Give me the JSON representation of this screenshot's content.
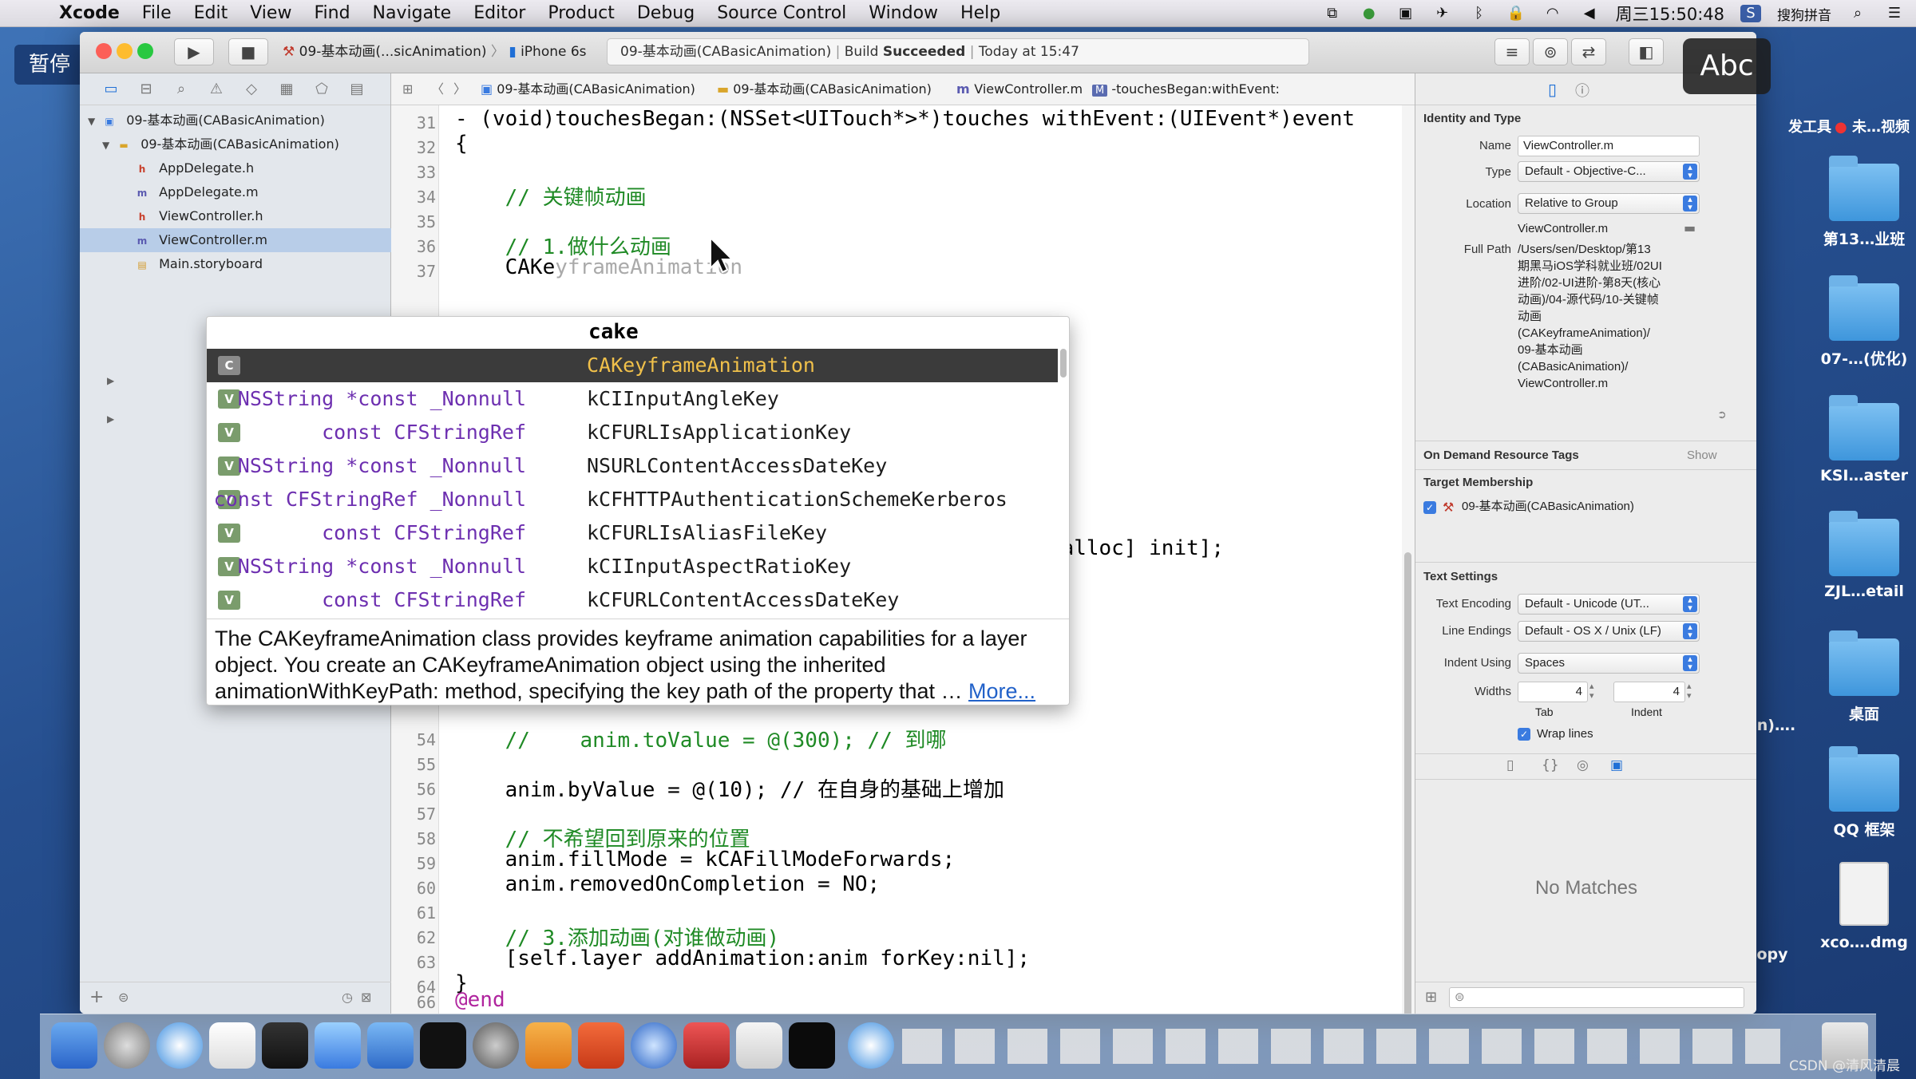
{
  "menubar": {
    "app_name": "Xcode",
    "items": [
      "File",
      "Edit",
      "View",
      "Find",
      "Navigate",
      "Editor",
      "Product",
      "Debug",
      "Source Control",
      "Window",
      "Help"
    ],
    "clock": "周三15:50:48",
    "ime": "搜狗拼音"
  },
  "overlay": {
    "pause_label": "暂停",
    "abc_label": "Abc"
  },
  "desktop_icons": [
    {
      "label": "发工具"
    },
    {
      "label": "未…视频"
    },
    {
      "label": "第13…业班"
    },
    {
      "label": "07-…(优化)"
    },
    {
      "label": "KSI…aster"
    },
    {
      "label": "ZJL…etail"
    },
    {
      "label": "桌面"
    },
    {
      "label": "n)…."
    },
    {
      "label": "QQ 框架"
    },
    {
      "label": "opy"
    },
    {
      "label": "xco….dmg"
    }
  ],
  "toolbar": {
    "scheme": "09-基本动画(...sicAnimation)",
    "device": "iPhone 6s",
    "activity_project": "09-基本动画(CABasicAnimation)",
    "activity_build": "Build",
    "activity_status": "Succeeded",
    "activity_time": "Today at 15:47"
  },
  "navigator": {
    "project": "09-基本动画(CABasicAnimation)",
    "group": "09-基本动画(CABasicAnimation)",
    "files": [
      {
        "name": "AppDelegate.h",
        "badge": "h"
      },
      {
        "name": "AppDelegate.m",
        "badge": "m"
      },
      {
        "name": "ViewController.h",
        "badge": "h"
      },
      {
        "name": "ViewController.m",
        "badge": "m",
        "selected": true
      },
      {
        "name": "Main.storyboard",
        "badge": "sb"
      }
    ]
  },
  "jumpbar": {
    "crumbs": [
      "09-基本动画(CABasicAnimation)",
      "09-基本动画(CABasicAnimation)",
      "ViewController.m",
      "-touchesBegan:withEvent:"
    ]
  },
  "editor": {
    "lines": [
      {
        "n": "31",
        "code": "- (void)touchesBegan:(NSSet<UITouch*>*)touches withEvent:(UIEvent*)event"
      },
      {
        "n": "32",
        "code": "{"
      },
      {
        "n": "33",
        "code": ""
      },
      {
        "n": "34",
        "code": "    // 关键帧动画"
      },
      {
        "n": "35",
        "code": ""
      },
      {
        "n": "36",
        "code": "    // 1.做什么动画"
      },
      {
        "n": "37",
        "code": "    CAKe"
      },
      {
        "n": "54",
        "code": "    //    anim.toValue = @(300); // 到哪"
      },
      {
        "n": "55",
        "code": ""
      },
      {
        "n": "56",
        "code": "    anim.byValue = @(10); // 在自身的基础上增加"
      },
      {
        "n": "57",
        "code": ""
      },
      {
        "n": "58",
        "code": "    // 不希望回到原来的位置"
      },
      {
        "n": "59",
        "code": "    anim.fillMode = kCAFillModeForwards;"
      },
      {
        "n": "60",
        "code": "    anim.removedOnCompletion = NO;"
      },
      {
        "n": "61",
        "code": ""
      },
      {
        "n": "62",
        "code": "    // 3.添加动画(对谁做动画)"
      },
      {
        "n": "63",
        "code": "    [self.layer addAnimation:anim forKey:nil];"
      },
      {
        "n": "64",
        "code": "}"
      },
      {
        "n": "65",
        "code": ""
      },
      {
        "n": "66",
        "code": "@end"
      }
    ],
    "ghost_suffix": "yframeAnimation",
    "hidden_fragment": "mation alloc] init];"
  },
  "completion": {
    "typed": "cake",
    "items": [
      {
        "kind": "C",
        "rtype": "",
        "name": "CAKeyframeAnimation"
      },
      {
        "kind": "V",
        "rtype": "NSString *const _Nonnull",
        "name": "kCIInputAngleKey"
      },
      {
        "kind": "V",
        "rtype": "const CFStringRef",
        "name": "kCFURLIsApplicationKey"
      },
      {
        "kind": "V",
        "rtype": "NSString *const _Nonnull",
        "name": "NSURLContentAccessDateKey"
      },
      {
        "kind": "V",
        "rtype": "const CFStringRef _Nonnull",
        "name": "kCFHTTPAuthenticationSchemeKerberos"
      },
      {
        "kind": "V",
        "rtype": "const CFStringRef",
        "name": "kCFURLIsAliasFileKey"
      },
      {
        "kind": "V",
        "rtype": "NSString *const _Nonnull",
        "name": "kCIInputAspectRatioKey"
      },
      {
        "kind": "V",
        "rtype": "const CFStringRef",
        "name": "kCFURLContentAccessDateKey"
      }
    ],
    "description": "The CAKeyframeAnimation class provides keyframe animation capabilities for a layer object. You create an CAKeyframeAnimation object using the inherited animationWithKeyPath: method, specifying the key path of the property that …",
    "more_link": "More..."
  },
  "inspector": {
    "identity_title": "Identity and Type",
    "name_label": "Name",
    "name_value": "ViewController.m",
    "type_label": "Type",
    "type_value": "Default - Objective-C...",
    "location_label": "Location",
    "location_value": "Relative to Group",
    "location_file": "ViewController.m",
    "fullpath_label": "Full Path",
    "fullpath_lines": [
      "/Users/sen/Desktop/第13",
      "期黑马iOS学科就业班/02UI",
      "进阶/02-UI进阶-第8天(核心",
      "动画)/04-源代码/10-关键帧",
      "动画",
      "(CAKeyframeAnimation)/",
      "09-基本动画",
      "(CABasicAnimation)/",
      "ViewController.m"
    ],
    "odr_title": "On Demand Resource Tags",
    "odr_show": "Show",
    "target_title": "Target Membership",
    "target_name": "09-基本动画(CABasicAnimation)",
    "text_title": "Text Settings",
    "encoding_label": "Text Encoding",
    "encoding_value": "Default - Unicode (UT...",
    "endings_label": "Line Endings",
    "endings_value": "Default - OS X / Unix (LF)",
    "indent_label": "Indent Using",
    "indent_value": "Spaces",
    "widths_label": "Widths",
    "tab_value": "4",
    "indent_width_value": "4",
    "tab_caption": "Tab",
    "indent_caption": "Indent",
    "wrap_label": "Wrap lines",
    "library_empty": "No Matches"
  },
  "watermark": "CSDN @清风清晨",
  "colors": {
    "selection": "#b8cde8",
    "completion_selected": "#3b3b3b",
    "accent": "#3a7be0"
  }
}
